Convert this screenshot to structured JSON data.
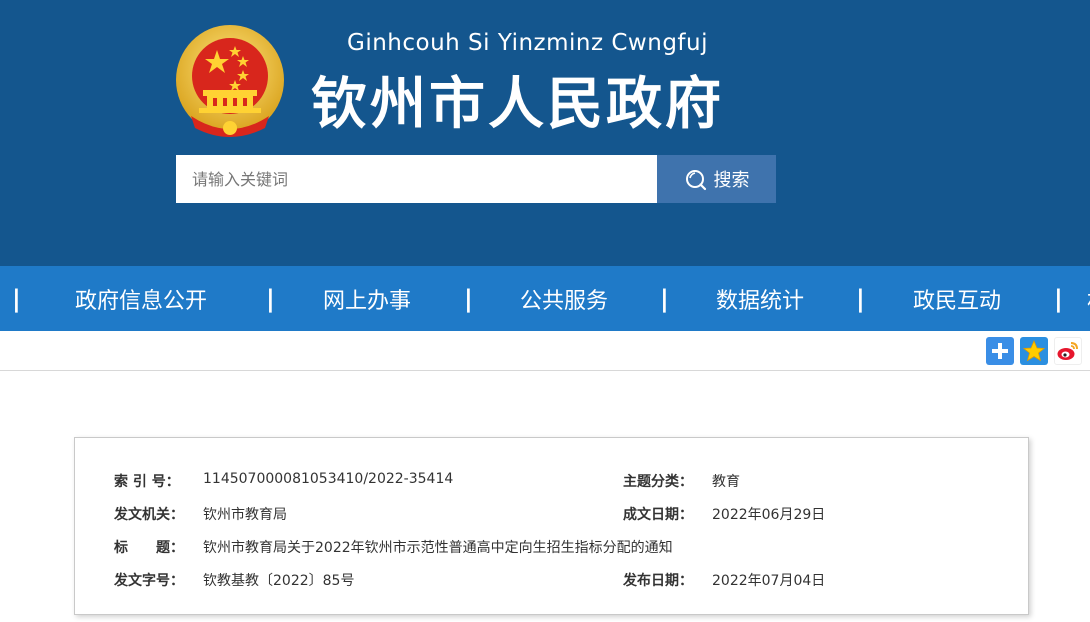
{
  "header": {
    "subtitle": "Ginhcouh Si Yinzminz Cwngfuj",
    "title": "钦州市人民政府",
    "search_placeholder": "请输入关键词",
    "search_button": "搜索",
    "bg_color": "#14568e"
  },
  "nav": {
    "bg_color": "#1f7ac8",
    "separator": "|",
    "items": [
      {
        "label": "政府信息公开"
      },
      {
        "label": "网上办事"
      },
      {
        "label": "公共服务"
      },
      {
        "label": "数据统计"
      },
      {
        "label": "政民互动"
      },
      {
        "label": "村"
      }
    ]
  },
  "share": {
    "icons": [
      "plus-share-icon",
      "qzone-star-icon",
      "weibo-icon"
    ]
  },
  "info": {
    "index_label": "索 引 号：",
    "index_value": "114507000081053410/2022-35414",
    "topic_label": "主题分类：",
    "topic_value": "教育",
    "issuer_label": "发文机关：",
    "issuer_value": "钦州市教育局",
    "date_label": "成文日期：",
    "date_value": "2022年06月29日",
    "title_label": "标　　题：",
    "title_value": "钦州市教育局关于2022年钦州市示范性普通高中定向生招生指标分配的通知",
    "docno_label": "发文字号：",
    "docno_value": "钦教基教〔2022〕85号",
    "pubdate_label": "发布日期：",
    "pubdate_value": "2022年07月04日"
  }
}
